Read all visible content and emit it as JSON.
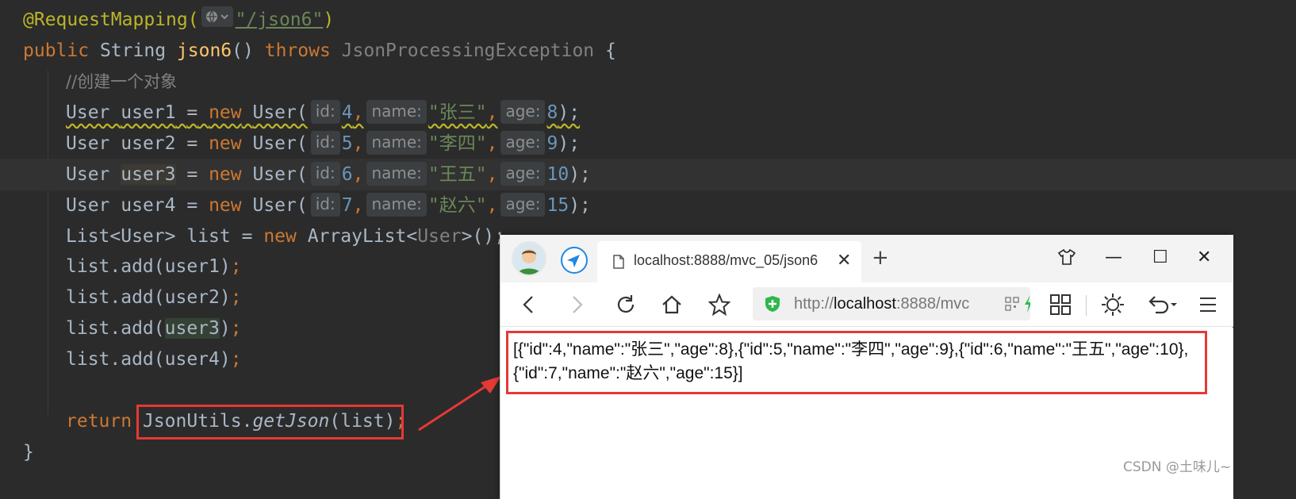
{
  "editor": {
    "annotation": "@RequestMapping(",
    "mapping_path": "\"/json6\"",
    "mapping_close": ")",
    "method_signature": {
      "kw_public": "public",
      "return_type": "String",
      "method_name": "json6",
      "parens": "()",
      "kw_throws": "throws",
      "exception": "JsonProcessingException",
      "brace": "{"
    },
    "comment": "//创建一个对象",
    "users": [
      {
        "type": "User",
        "var": "user1",
        "eq": "=",
        "kw_new": "new",
        "ctor": "User(",
        "id_hint": "id:",
        "id": "4",
        "name_hint": "name:",
        "name": "\"张三\"",
        "age_hint": "age:",
        "age": "8",
        "end": ");"
      },
      {
        "type": "User",
        "var": "user2",
        "eq": "=",
        "kw_new": "new",
        "ctor": "User(",
        "id_hint": "id:",
        "id": "5",
        "name_hint": "name:",
        "name": "\"李四\"",
        "age_hint": "age:",
        "age": "9",
        "end": ");"
      },
      {
        "type": "User",
        "var": "user3",
        "eq": "=",
        "kw_new": "new",
        "ctor": "User(",
        "id_hint": "id:",
        "id": "6",
        "name_hint": "name:",
        "name": "\"王五\"",
        "age_hint": "age:",
        "age": "10",
        "end": ");"
      },
      {
        "type": "User",
        "var": "user4",
        "eq": "=",
        "kw_new": "new",
        "ctor": "User(",
        "id_hint": "id:",
        "id": "7",
        "name_hint": "name:",
        "name": "\"赵六\"",
        "age_hint": "age:",
        "age": "15",
        "end": ");"
      }
    ],
    "list_decl": {
      "type": "List<User>",
      "var": "list",
      "eq": "=",
      "kw_new": "new",
      "ctor": "ArrayList<",
      "generic": "User",
      "end": ">();"
    },
    "list_adds": [
      {
        "call": "list.add(",
        "arg": "user1",
        "end": ")",
        "semi": ";"
      },
      {
        "call": "list.add(",
        "arg": "user2",
        "end": ")",
        "semi": ";"
      },
      {
        "call": "list.add(",
        "arg": "user3",
        "end": ")",
        "semi": ";"
      },
      {
        "call": "list.add(",
        "arg": "user4",
        "end": ")",
        "semi": ";"
      }
    ],
    "return_line": {
      "kw_return": "return",
      "cls": "JsonUtils.",
      "method": "getJson",
      "args": "(list)",
      "semi": ";"
    },
    "closing_brace": "}"
  },
  "browser": {
    "tab_title": "localhost:8888/mvc_05/json6",
    "tab_close": "✕",
    "new_tab": "+",
    "window_buttons": {
      "minimize": "—",
      "maximize": "☐",
      "close": "✕"
    },
    "address": {
      "scheme": "http://",
      "host": "localhost",
      "rest": ":8888/mvc"
    },
    "content_json": "[{\"id\":4,\"name\":\"张三\",\"age\":8},{\"id\":5,\"name\":\"李四\",\"age\":9},{\"id\":6,\"name\":\"王五\",\"age\":10},{\"id\":7,\"name\":\"赵六\",\"age\":15}]"
  },
  "watermark": "CSDN @土味儿~",
  "colors": {
    "editor_bg": "#2b2b2b",
    "keyword": "#cc7832",
    "string": "#6a8759",
    "number": "#6897bb",
    "method": "#ffc66d",
    "annotation": "#bbb529",
    "highlight_box": "#e53935"
  }
}
